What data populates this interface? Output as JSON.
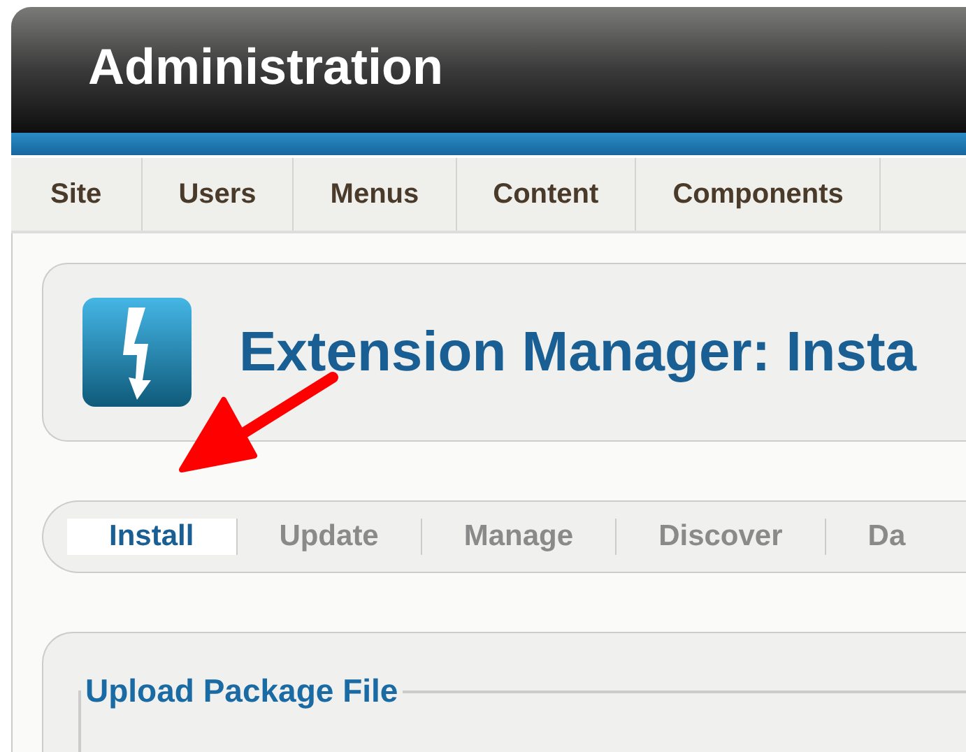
{
  "header": {
    "title": "Administration"
  },
  "menu": [
    {
      "label": "Site"
    },
    {
      "label": "Users"
    },
    {
      "label": "Menus"
    },
    {
      "label": "Content"
    },
    {
      "label": "Components"
    }
  ],
  "page_title": "Extension Manager: Insta",
  "subnav": [
    {
      "label": "Install",
      "selected": true
    },
    {
      "label": "Update",
      "selected": false
    },
    {
      "label": "Manage",
      "selected": false
    },
    {
      "label": "Discover",
      "selected": false
    },
    {
      "label": "Da",
      "selected": false
    }
  ],
  "upload": {
    "legend": "Upload Package File"
  }
}
